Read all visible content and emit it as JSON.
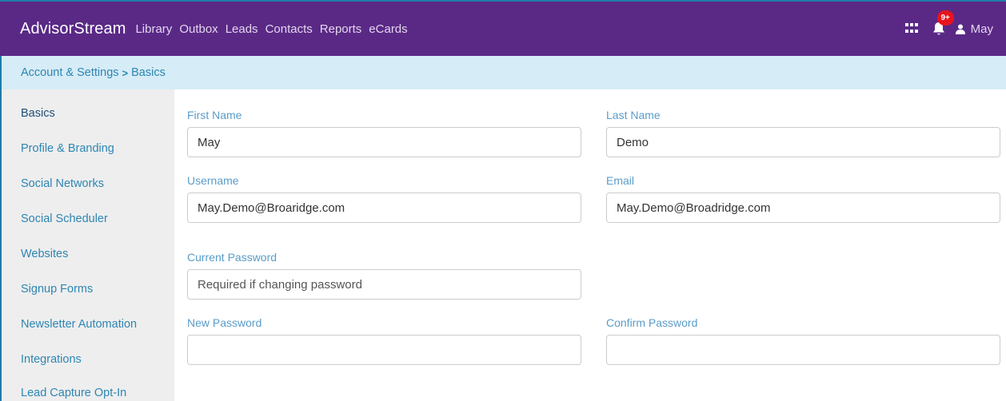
{
  "header": {
    "brand": "AdvisorStream",
    "nav": [
      "Library",
      "Outbox",
      "Leads",
      "Contacts",
      "Reports",
      "eCards"
    ],
    "notification_count": "9+",
    "user_name": "May",
    "colors": {
      "bar": "#5a2986",
      "badge": "#e8141c"
    }
  },
  "breadcrumb": {
    "parent": "Account & Settings",
    "separator": ">",
    "current": "Basics"
  },
  "sidebar": {
    "items": [
      {
        "label": "Basics",
        "active": true
      },
      {
        "label": "Profile & Branding"
      },
      {
        "label": "Social Networks"
      },
      {
        "label": "Social Scheduler"
      },
      {
        "label": "Websites"
      },
      {
        "label": "Signup Forms"
      },
      {
        "label": "Newsletter Automation"
      },
      {
        "label": "Integrations"
      },
      {
        "label": "Lead Capture Opt-In"
      }
    ]
  },
  "form": {
    "first_name": {
      "label": "First Name",
      "value": "May"
    },
    "last_name": {
      "label": "Last Name",
      "value": "Demo"
    },
    "username": {
      "label": "Username",
      "value": "May.Demo@Broaridge.com"
    },
    "email": {
      "label": "Email",
      "value": "May.Demo@Broadridge.com"
    },
    "current_password": {
      "label": "Current Password",
      "placeholder": "Required if changing password",
      "value": ""
    },
    "new_password": {
      "label": "New Password",
      "value": ""
    },
    "confirm_password": {
      "label": "Confirm Password",
      "value": ""
    }
  },
  "icons": [
    "grid-icon",
    "bell-icon",
    "user-icon"
  ]
}
